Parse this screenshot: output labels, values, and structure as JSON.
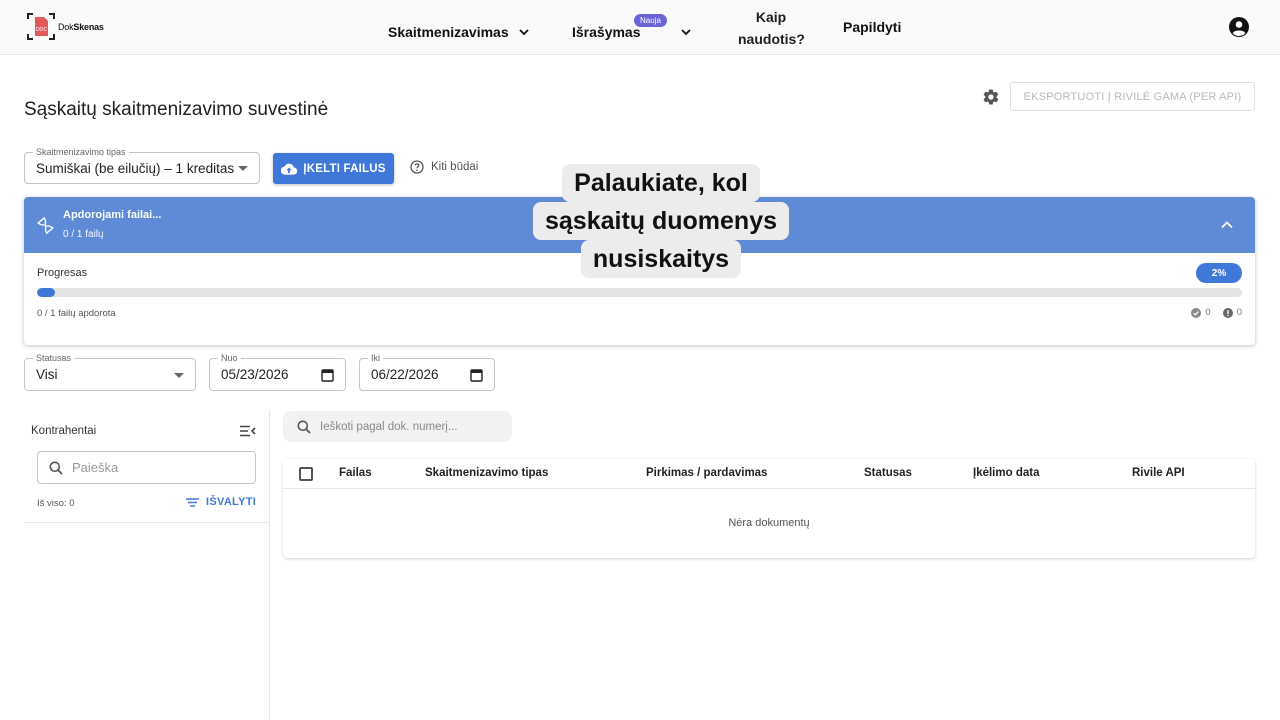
{
  "header": {
    "logo_text_plain": "Dok",
    "logo_text_bold": "Skenas",
    "logo_mark_text": "DOC",
    "nav": {
      "digitization": "Skaitmenizavimas",
      "invoicing": "Išrašymas",
      "invoicing_badge": "Nauja",
      "howto_line1": "Kaip",
      "howto_line2": "naudotis?",
      "topup": "Papildyti"
    }
  },
  "page": {
    "title": "Sąskaitų skaitmenizavimo suvestinė",
    "export_button": "EKSPORTUOTI Į RIVILĖ GAMA (PER API)"
  },
  "upload": {
    "type_label": "Skaitmenizavimo tipas",
    "type_value": "Sumiškai (be eilučių) – 1 kreditas",
    "upload_button": "ĮKELTI FAILUS",
    "other_ways": "Kiti būdai"
  },
  "processing": {
    "title": "Apdorojami failai...",
    "subtitle": "0 / 1 failų",
    "progress_label": "Progresas",
    "progress_percent_text": "2%",
    "progress_fraction": 0.015,
    "files_done": "0 / 1 failų apdorota",
    "success_count": "0",
    "error_count": "0"
  },
  "overlay": {
    "line1": "Palaukiate, kol",
    "line2": "sąskaitų duomenys",
    "line3": "nusiskaitys"
  },
  "filters": {
    "status_label": "Statusas",
    "status_value": "Visi",
    "from_label": "Nuo",
    "from_value": "05/23/2026",
    "to_label": "Iki",
    "to_value": "06/22/2026"
  },
  "sidebar": {
    "title": "Kontrahentai",
    "search_placeholder": "Paieška",
    "total": "Iš viso: 0",
    "clear_button": "IŠVALYTI"
  },
  "documents": {
    "search_placeholder": "Ieškoti pagal dok. numerį...",
    "columns": [
      "Failas",
      "Skaitmenizavimo tipas",
      "Pirkimas / pardavimas",
      "Statusas",
      "Įkėlimo data",
      "Rivile API"
    ],
    "empty_text": "Nėra dokumentų"
  }
}
